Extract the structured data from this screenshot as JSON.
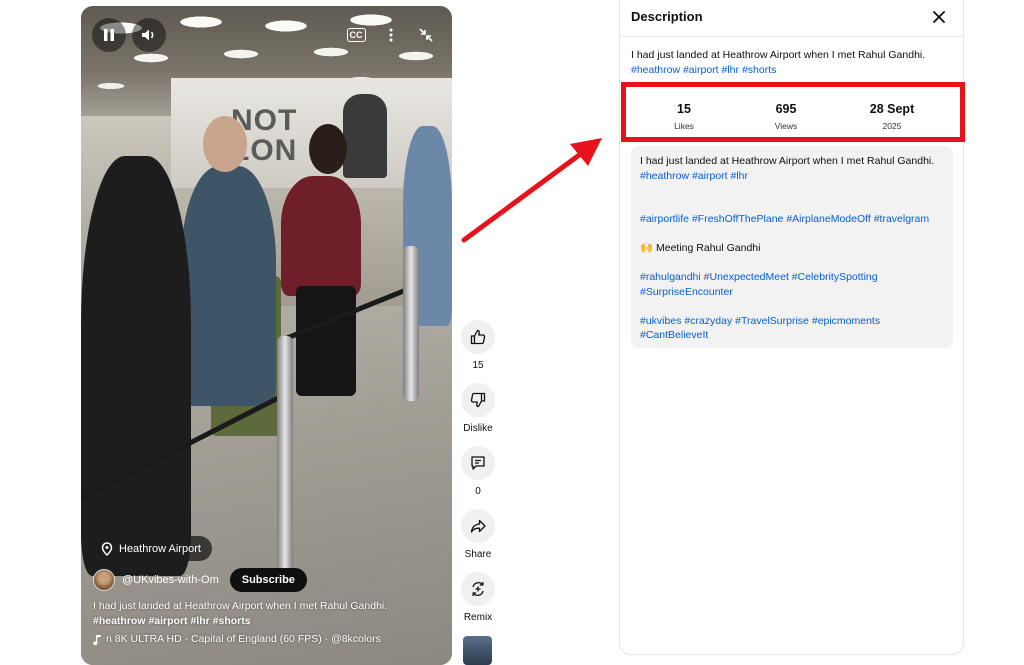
{
  "player": {
    "pause_icon": "pause-icon",
    "volume_icon": "volume-icon",
    "cc_label": "CC",
    "more_icon": "more-vert-icon",
    "collapse_icon": "collapse-icon",
    "billboard_text": "NOT\nLON"
  },
  "overlay": {
    "location": "Heathrow Airport",
    "channel": "@UKvibes-with-Om",
    "subscribe": "Subscribe",
    "caption_text": "I had just landed at Heathrow Airport when I met Rahul Gandhi. ",
    "caption_tags": [
      "#heathrow",
      "#airport",
      "#lhr",
      "#shorts"
    ],
    "music": "n 8K ULTRA HD - Capital of England (60 FPS) · @8kcolors"
  },
  "rail": {
    "like_count": "15",
    "dislike_label": "Dislike",
    "comment_count": "0",
    "share_label": "Share",
    "remix_label": "Remix"
  },
  "panel": {
    "title": "Description",
    "summary_text": "I had just landed at Heathrow Airport when I met Rahul Gandhi.",
    "summary_tags": [
      "#heathrow",
      "#airport",
      "#lhr",
      "#shorts"
    ],
    "stats": [
      {
        "value": "15",
        "label": "Likes"
      },
      {
        "value": "695",
        "label": "Views"
      },
      {
        "value": "28 Sept",
        "label": "2025"
      }
    ],
    "description": {
      "line1": "I had just landed at Heathrow Airport when I met Rahul Gandhi.",
      "line1_tags": [
        "#heathrow",
        "#airport",
        "#lhr"
      ],
      "block2_tags": [
        "#airportlife",
        "#FreshOffThePlane",
        "#AirplaneModeOff",
        "#travelgram"
      ],
      "emoji": "🙌",
      "block3_text": "Meeting Rahul Gandhi",
      "block4_tags": [
        "#rahulgandhi",
        "#UnexpectedMeet",
        "#CelebritySpotting",
        "#SurpriseEncounter"
      ],
      "block5_tags": [
        "#ukvibes",
        "#crazyday",
        "#TravelSurprise",
        "#epicmoments",
        "#CantBelieveIt"
      ]
    }
  },
  "annotation": {
    "highlight_color": "#e8131a"
  }
}
